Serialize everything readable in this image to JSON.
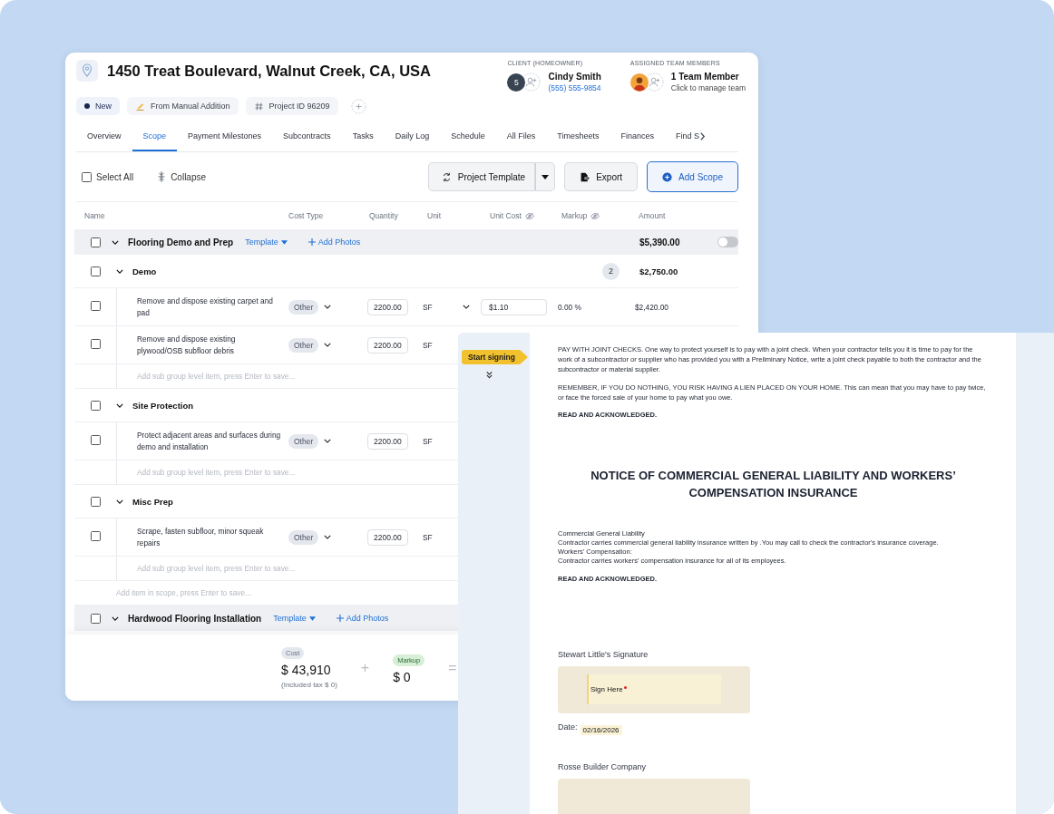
{
  "project": {
    "address": "1450 Treat Boulevard, Walnut Creek, CA, USA",
    "chips": [
      {
        "kind": "status",
        "label": "New"
      },
      {
        "kind": "source",
        "label": "From Manual Addition"
      },
      {
        "kind": "id",
        "label": "Project ID 96209"
      }
    ]
  },
  "client": {
    "heading": "CLIENT (HOMEOWNER)",
    "avatar": "5",
    "name": "Cindy Smith",
    "phone": "(555) 555-9854"
  },
  "team": {
    "heading": "ASSIGNED TEAM MEMBERS",
    "name": "1 Team Member",
    "hint": "Click to manage team"
  },
  "tabs": [
    {
      "label": "Overview",
      "selected": false
    },
    {
      "label": "Scope",
      "selected": true
    },
    {
      "label": "Payment Milestones",
      "selected": false
    },
    {
      "label": "Subcontracts",
      "selected": false
    },
    {
      "label": "Tasks",
      "selected": false
    },
    {
      "label": "Daily Log",
      "selected": false
    },
    {
      "label": "Schedule",
      "selected": false
    },
    {
      "label": "All Files",
      "selected": false
    },
    {
      "label": "Timesheets",
      "selected": false
    },
    {
      "label": "Finances",
      "selected": false
    },
    {
      "label": "Find S",
      "selected": false
    }
  ],
  "toolbar": {
    "select_all": {
      "label": "Select All",
      "checked": false
    },
    "collapse": "Collapse",
    "template_button": "Project Template",
    "export_button": "Export",
    "add_button": "Add Scope"
  },
  "columns": [
    {
      "label": "Name",
      "hidden": false
    },
    {
      "label": "Cost Type",
      "hidden": false
    },
    {
      "label": "Quantity",
      "hidden": false
    },
    {
      "label": "Unit",
      "hidden": false
    },
    {
      "label": "Unit Cost",
      "hidden": true
    },
    {
      "label": "Markup",
      "hidden": true
    },
    {
      "label": "Amount",
      "hidden": false
    }
  ],
  "groups": [
    {
      "name": "Flooring Demo and Prep",
      "checked": false,
      "template": "Template",
      "add_photos": "Add Photos",
      "amount": "$5,390.00",
      "toggle_on": false,
      "subgroups": [
        {
          "name": "Demo",
          "checked": false,
          "count": "2",
          "amount": "$2,750.00",
          "items": [
            {
              "name": "Remove and dispose existing carpet and pad",
              "checked": false,
              "cost_type": "Other",
              "quantity": "2200.00",
              "unit": "SF",
              "unit_cost": "$1.10",
              "markup": "0.00 %",
              "amount": "$2,420.00"
            },
            {
              "name": "Remove and dispose existing plywood/OSB subfloor debris",
              "checked": false,
              "cost_type": "Other",
              "quantity": "2200.00",
              "unit": "SF"
            }
          ],
          "add_placeholder": "Add sub group level item, press Enter to save..."
        },
        {
          "name": "Site Protection",
          "checked": false,
          "items": [
            {
              "name": "Protect adjacent areas and surfaces during demo and installation",
              "checked": false,
              "cost_type": "Other",
              "quantity": "2200.00",
              "unit": "SF"
            }
          ],
          "add_placeholder": "Add sub group level item, press Enter to save..."
        },
        {
          "name": "Misc Prep",
          "checked": false,
          "items": [
            {
              "name": "Scrape, fasten subfloor, minor squeak repairs",
              "checked": false,
              "cost_type": "Other",
              "quantity": "2200.00",
              "unit": "SF"
            }
          ],
          "add_placeholder": "Add sub group level item, press Enter to save..."
        }
      ],
      "add_placeholder": "Add item in scope, press Enter to save..."
    },
    {
      "name": "Hardwood Flooring Installation",
      "checked": false,
      "template": "Template",
      "add_photos": "Add Photos"
    }
  ],
  "totals": {
    "cost_label": "Cost",
    "cost": "$ 43,910",
    "tax_note": "(Included tax $ 0)",
    "plus": "+",
    "markup_label": "Markup",
    "markup": "$ 0",
    "equals": "="
  },
  "document": {
    "tag": "Start signing",
    "blocks": [
      {
        "kind": "paragraph",
        "text": "PAY WITH JOINT CHECKS. One way to protect yourself is to pay with a joint check. When your contractor tells you it is time to pay for the work of a subcontractor or supplier who has provided you with a Preliminary Notice, write a joint check payable to both the contractor and the subcontractor or material supplier."
      },
      {
        "kind": "paragraph",
        "text": "REMEMBER, IF YOU DO NOTHING, YOU RISK HAVING A LIEN PLACED ON YOUR HOME. This can mean that you may have to pay twice, or face the forced sale of your home to pay what you owe."
      },
      {
        "kind": "strong",
        "text": "READ AND ACKNOWLEDGED."
      },
      {
        "kind": "heading",
        "text": "NOTICE OF COMMERCIAL GENERAL LIABILITY AND WORKERS’ COMPENSATION INSURANCE"
      },
      {
        "kind": "lines",
        "lines": [
          "Commercial General Liability",
          "Contractor carries commercial general liability insurance written by    .You may call    to check the contractor's insurance coverage.",
          "Workers' Compensation:",
          "Contractor carries workers' compensation insurance for all of its employees."
        ]
      },
      {
        "kind": "strong",
        "text": "READ AND ACKNOWLEDGED."
      },
      {
        "kind": "signature",
        "label": "Stewart Little's Signature",
        "button": "Sign Here",
        "required": true,
        "date_label": "Date:",
        "date": "02/16/2026"
      },
      {
        "kind": "signature",
        "label": "Rosse Builder Company"
      }
    ]
  }
}
